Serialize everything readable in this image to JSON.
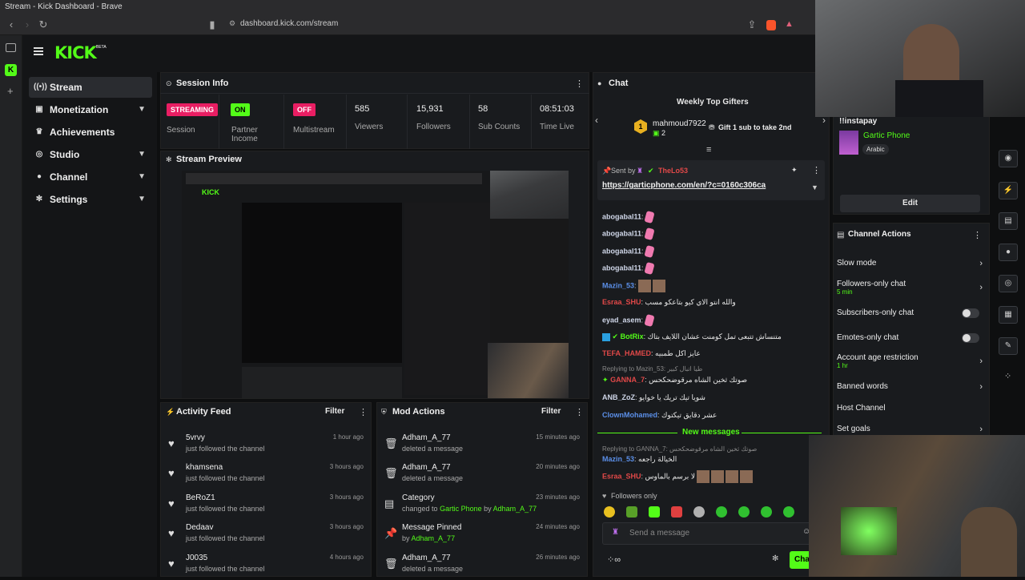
{
  "browser": {
    "title": "Stream - Kick Dashboard - Brave",
    "url": "dashboard.kick.com/stream"
  },
  "app": {
    "logo": "KICK",
    "beta": "BETA"
  },
  "sidebar": {
    "items": [
      {
        "label": "Stream",
        "icon": "broadcast-icon",
        "active": true
      },
      {
        "label": "Monetization",
        "icon": "dollar-icon",
        "chevron": true
      },
      {
        "label": "Achievements",
        "icon": "trophy-icon"
      },
      {
        "label": "Studio",
        "icon": "studio-icon",
        "chevron": true
      },
      {
        "label": "Channel",
        "icon": "user-icon",
        "chevron": true
      },
      {
        "label": "Settings",
        "icon": "gear-icon",
        "chevron": true
      }
    ]
  },
  "session": {
    "title": "Session Info",
    "streaming": "STREAMING",
    "streaming_label": "Session",
    "partner": "ON",
    "partner_label": "Partner Income",
    "multistream": "OFF",
    "multistream_label": "Multistream",
    "viewers": "585",
    "viewers_label": "Viewers",
    "followers": "15,931",
    "followers_label": "Followers",
    "subs": "58",
    "subs_label": "Sub Counts",
    "time": "08:51:03",
    "time_label": "Time Live"
  },
  "preview": {
    "title": "Stream Preview"
  },
  "activity": {
    "title": "Activity Feed",
    "filter": "Filter",
    "rows": [
      {
        "name": "5vrvy",
        "action": "just followed the channel",
        "time": "1 hour ago"
      },
      {
        "name": "khamsena",
        "action": "just followed the channel",
        "time": "3 hours ago"
      },
      {
        "name": "BeRoZ1",
        "action": "just followed the channel",
        "time": "3 hours ago"
      },
      {
        "name": "Dedaav",
        "action": "just followed the channel",
        "time": "3 hours ago"
      },
      {
        "name": "J0035",
        "action": "just followed the channel",
        "time": "4 hours ago"
      }
    ]
  },
  "mod": {
    "title": "Mod Actions",
    "filter": "Filter",
    "rows": [
      {
        "name": "Adham_A_77",
        "line": "deleted a message",
        "time": "15 minutes ago"
      },
      {
        "name": "Adham_A_77",
        "line": "deleted a message",
        "time": "20 minutes ago"
      },
      {
        "name": "Category",
        "line_pre": "changed to",
        "line_hl": "Gartic Phone",
        "line_mid": "by",
        "line_user": "Adham_A_77",
        "time": "23 minutes ago"
      },
      {
        "name": "Message Pinned",
        "line_pre": "by",
        "line_user": "Adham_A_77",
        "time": "24 minutes ago"
      },
      {
        "name": "Adham_A_77",
        "line": "deleted a message",
        "time": "26 minutes ago"
      }
    ]
  },
  "chat": {
    "title": "Chat",
    "gifters_title": "Weekly Top Gifters",
    "gifter_name": "mahmoud7922",
    "gifter_count": "2",
    "gift_btn": "Gift 1 sub to take 2nd",
    "pinned_sent_by": "Sent by",
    "pinned_user": "TheLo53",
    "pinned_link": "https://garticphone.com/en/?c=0160c306ca",
    "lines": [
      {
        "user": "abogabal11",
        "text": ""
      },
      {
        "user": "abogabal11",
        "text": ""
      },
      {
        "user": "abogabal11",
        "text": ""
      },
      {
        "user": "abogabal11",
        "text": ""
      },
      {
        "user": "Mazin_53",
        "text": ""
      },
      {
        "user": "Esraa_SHU",
        "text": "والله انتو الاي كيو بتاعكو مسب"
      },
      {
        "user": "eyad_asem",
        "text": ""
      },
      {
        "user": "BotRix",
        "text": "متنساش تتبعى تمل كومنت عشان اللايف بتاك"
      },
      {
        "user": "TEFA_HAMED",
        "text": "عايز اكل طمبيه"
      },
      {
        "user": "GANNA_7",
        "text": "صوتك ثخين الشاه مرقوضحكحس",
        "reply": "Replying to Mazin_53: طيا اتبال كبير"
      },
      {
        "user": "ANB_ZoZ",
        "text": "شويا تيك تريك يا خوايو"
      },
      {
        "user": "ClownMohamed",
        "text": "عشر دقايق تيكتوك"
      }
    ],
    "new_messages": "New messages",
    "reply2": "Replying to GANNA_7: صوتك ثخين الشاه مرقوضحكحس",
    "lines2": [
      {
        "user": "Mazin_53",
        "text": "الخيالة راجعه"
      },
      {
        "user": "Esraa_SHU",
        "text": "لا برسم بالماوس"
      }
    ],
    "followers_only": "Followers only",
    "input_placeholder": "Send a message",
    "send": "Chat"
  },
  "right": {
    "command": "!!instapay",
    "category": "Gartic Phone",
    "tag": "Arabic",
    "edit": "Edit",
    "actions_title": "Channel Actions",
    "actions": [
      {
        "label": "Slow mode"
      },
      {
        "label": "Followers-only chat",
        "sub": "5 min"
      },
      {
        "label": "Subscribers-only chat"
      },
      {
        "label": "Emotes-only chat"
      },
      {
        "label": "Account age restriction",
        "sub": "1 hr"
      },
      {
        "label": "Banned words"
      },
      {
        "label": "Host Channel"
      },
      {
        "label": "Set goals"
      }
    ]
  },
  "colors": {
    "brand": "#53fc18",
    "streaming": "#e91e63",
    "panel": "#191b1e"
  }
}
